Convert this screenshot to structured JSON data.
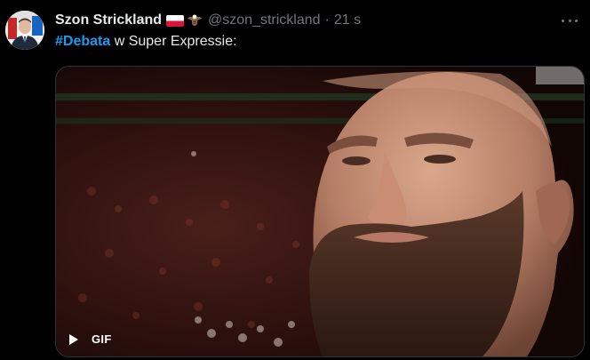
{
  "tweet": {
    "author": {
      "display_name": "Szon Strickland",
      "handle": "@szon_strickland",
      "badges": [
        "poland-flag-icon",
        "eagle-icon"
      ]
    },
    "separator": "·",
    "time": "21 s",
    "text": {
      "hashtag": "#Debata",
      "rest": " w Super Expressie:"
    },
    "media": {
      "type": "gif",
      "label": "GIF",
      "play_icon": "play-icon"
    },
    "more_icon": "more-horizontal-icon"
  },
  "colors": {
    "background": "#000000",
    "text_primary": "#e7e9ea",
    "text_secondary": "#71767b",
    "link": "#1d9bf0"
  }
}
